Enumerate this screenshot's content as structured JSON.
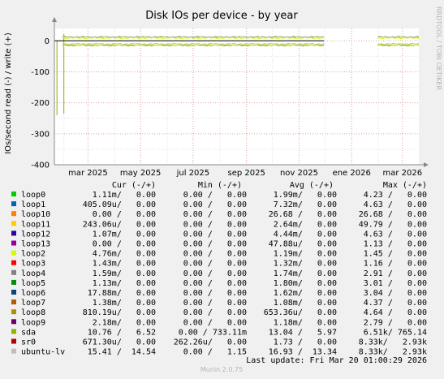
{
  "colors": {
    "background": "#f0f0f0",
    "plot_background": "#ffffff",
    "grid_major": "#e6a0a0",
    "grid_minor": "#dedede",
    "axis": "#888888"
  },
  "side_text": "RRDTOOL / TOBI OETIKER",
  "footer": "Munin 2.0.75",
  "chart_data": {
    "type": "line",
    "title": "Disk IOs per device - by year",
    "ylabel": "IOs/second read (-) / write (+)",
    "ylim": [
      -400,
      40
    ],
    "yticks": [
      -400,
      -300,
      -200,
      -100,
      0
    ],
    "x_range": [
      "2025-01-21",
      "2026-03-20"
    ],
    "xticks": [
      {
        "label": "mar 2025",
        "date": "2025-03-01"
      },
      {
        "label": "may 2025",
        "date": "2025-05-01"
      },
      {
        "label": "jul 2025",
        "date": "2025-07-01"
      },
      {
        "label": "sep 2025",
        "date": "2025-09-01"
      },
      {
        "label": "nov 2025",
        "date": "2025-11-01"
      },
      {
        "label": "ene 2026",
        "date": "2026-01-01"
      },
      {
        "label": "mar 2026",
        "date": "2026-03-01"
      }
    ],
    "series": [
      {
        "name": "sda",
        "color": "#8ab000",
        "read_y": -15,
        "write_y": 12,
        "segments": [
          [
            "2025-01-30",
            "2025-11-30"
          ],
          [
            "2026-01-31",
            "2026-03-20"
          ]
        ],
        "spikes": [
          {
            "date": "2025-01-24",
            "value": -240
          },
          {
            "date": "2025-02-01",
            "value": -235
          },
          {
            "date": "2025-02-01",
            "value": 22
          }
        ]
      },
      {
        "name": "loop2",
        "color": "#ccff00",
        "read_y": -13,
        "write_y": 9,
        "segments": [
          [
            "2025-01-30",
            "2025-11-30"
          ],
          [
            "2026-01-31",
            "2026-03-20"
          ]
        ],
        "spikes": []
      },
      {
        "name": "ubuntu-lv",
        "color": "#bbbbbb",
        "read_y": -10,
        "write_y": 13,
        "segments": [
          [
            "2025-01-30",
            "2025-11-30"
          ],
          [
            "2026-01-31",
            "2026-03-20"
          ]
        ],
        "spikes": []
      }
    ],
    "zero_line_end": "2025-11-30",
    "legend_header": {
      "cur": "Cur (-/+)",
      "min": "Min (-/+)",
      "avg": "Avg (-/+)",
      "max": "Max (-/+)"
    },
    "legend": [
      {
        "name": "loop0",
        "color": "#00cc00",
        "cur": "1.11m/   0.00",
        "min": "0.00 /   0.00",
        "avg": "1.99m/   0.00",
        "max": "4.23 /   0.00"
      },
      {
        "name": "loop1",
        "color": "#0066b3",
        "cur": "405.09u/   0.00",
        "min": "0.00 /   0.00",
        "avg": "7.32m/   0.00",
        "max": "4.63 /   0.00"
      },
      {
        "name": "loop10",
        "color": "#ff8000",
        "cur": "0.00 /   0.00",
        "min": "0.00 /   0.00",
        "avg": "26.68 /   0.00",
        "max": "26.68 /   0.00"
      },
      {
        "name": "loop11",
        "color": "#ffcc00",
        "cur": "243.06u/   0.00",
        "min": "0.00 /   0.00",
        "avg": "2.64m/   0.00",
        "max": "49.79 /   0.00"
      },
      {
        "name": "loop12",
        "color": "#330099",
        "cur": "1.07m/   0.00",
        "min": "0.00 /   0.00",
        "avg": "4.44m/   0.00",
        "max": "4.63 /   0.00"
      },
      {
        "name": "loop13",
        "color": "#990099",
        "cur": "0.00 /   0.00",
        "min": "0.00 /   0.00",
        "avg": "47.88u/   0.00",
        "max": "1.13 /   0.00"
      },
      {
        "name": "loop2",
        "color": "#ccff00",
        "cur": "4.76m/   0.00",
        "min": "0.00 /   0.00",
        "avg": "1.19m/   0.00",
        "max": "1.45 /   0.00"
      },
      {
        "name": "loop3",
        "color": "#ff0000",
        "cur": "1.43m/   0.00",
        "min": "0.00 /   0.00",
        "avg": "1.32m/   0.00",
        "max": "1.16 /   0.00"
      },
      {
        "name": "loop4",
        "color": "#808080",
        "cur": "1.59m/   0.00",
        "min": "0.00 /   0.00",
        "avg": "1.74m/   0.00",
        "max": "2.91 /   0.00"
      },
      {
        "name": "loop5",
        "color": "#008f00",
        "cur": "1.13m/   0.00",
        "min": "0.00 /   0.00",
        "avg": "1.80m/   0.00",
        "max": "3.01 /   0.00"
      },
      {
        "name": "loop6",
        "color": "#00487d",
        "cur": "17.88m/   0.00",
        "min": "0.00 /   0.00",
        "avg": "1.62m/   0.00",
        "max": "3.04 /   0.00"
      },
      {
        "name": "loop7",
        "color": "#b35a00",
        "cur": "1.38m/   0.00",
        "min": "0.00 /   0.00",
        "avg": "1.08m/   0.00",
        "max": "4.37 /   0.00"
      },
      {
        "name": "loop8",
        "color": "#b38f00",
        "cur": "810.19u/   0.00",
        "min": "0.00 /   0.00",
        "avg": "653.36u/   0.00",
        "max": "4.64 /   0.00"
      },
      {
        "name": "loop9",
        "color": "#6b006b",
        "cur": "2.18m/   0.00",
        "min": "0.00 /   0.00",
        "avg": "1.18m/   0.00",
        "max": "2.79 /   0.00"
      },
      {
        "name": "sda",
        "color": "#8fb300",
        "cur": "10.76 /   6.52",
        "min": "0.00 / 733.11m",
        "avg": "13.04 /   5.97",
        "max": "6.51k/ 765.14"
      },
      {
        "name": "sr0",
        "color": "#b30000",
        "cur": "671.30u/   0.00",
        "min": "262.26u/   0.00",
        "avg": "1.73 /   0.00",
        "max": "8.33k/   2.93k"
      },
      {
        "name": "ubuntu-lv",
        "color": "#bebebe",
        "cur": "15.41 /  14.54",
        "min": "0.00 /   1.15",
        "avg": "16.93 /  13.34",
        "max": "8.33k/   2.93k"
      }
    ],
    "last_update": "Last update: Fri Mar 20 01:00:29 2026"
  }
}
